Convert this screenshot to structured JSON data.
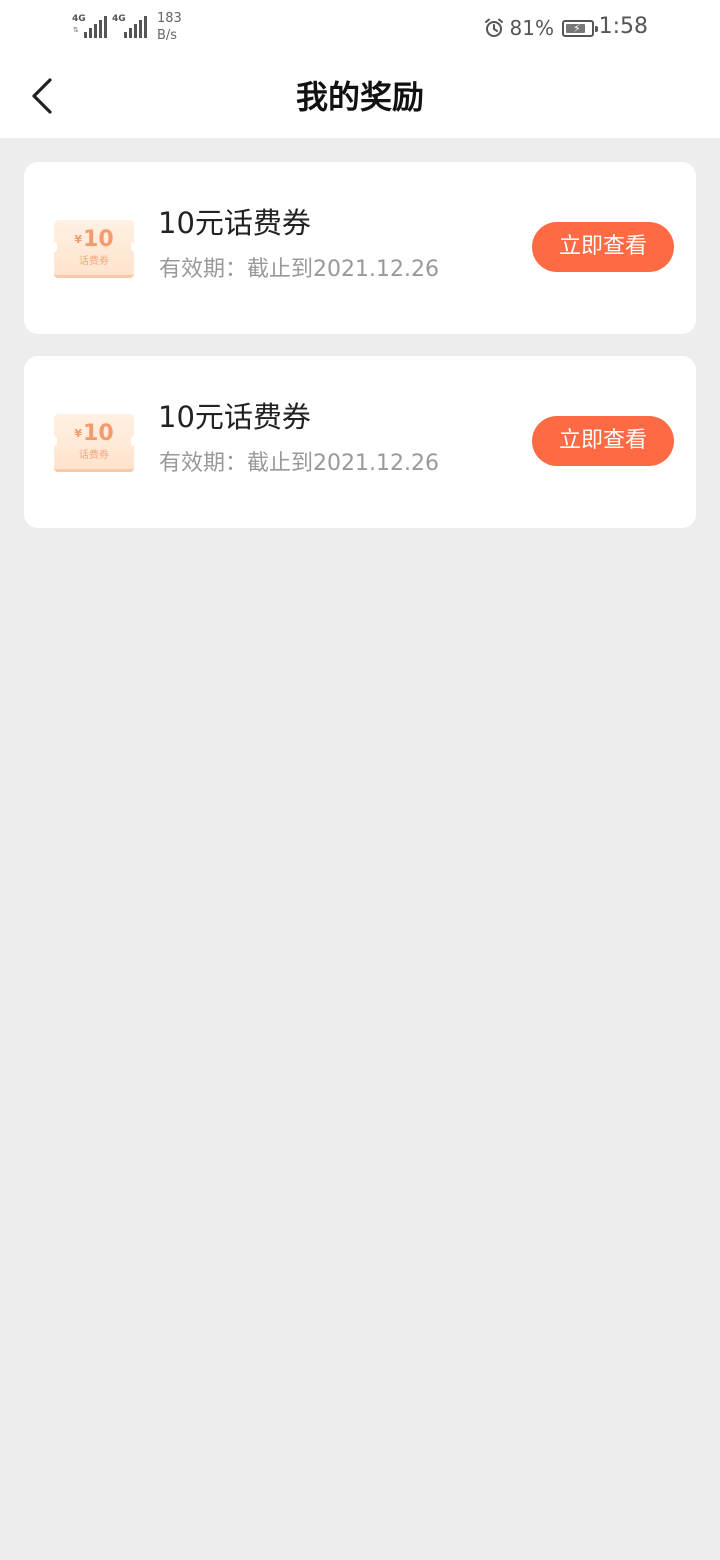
{
  "status_bar": {
    "network_1": "4G",
    "network_2": "4G",
    "speed_value": "183",
    "speed_unit": "B/s",
    "battery_percent": "81%",
    "battery_level": 0.81,
    "time": "1:58",
    "icons": [
      "signal-icon",
      "alarm-icon",
      "battery-charging-icon"
    ]
  },
  "header": {
    "title": "我的奖励",
    "back_icon": "chevron-left-icon"
  },
  "colors": {
    "background": "#ededed",
    "card": "#ffffff",
    "accent": "#fd6a43",
    "coupon": "#ffe3cc"
  },
  "rewards": [
    {
      "coupon_amount": "10",
      "coupon_currency": "¥",
      "coupon_label": "话费券",
      "title": "10元话费券",
      "validity": "有效期：截止到2021.12.26",
      "button_label": "立即查看"
    },
    {
      "coupon_amount": "10",
      "coupon_currency": "¥",
      "coupon_label": "话费券",
      "title": "10元话费券",
      "validity": "有效期：截止到2021.12.26",
      "button_label": "立即查看"
    }
  ]
}
